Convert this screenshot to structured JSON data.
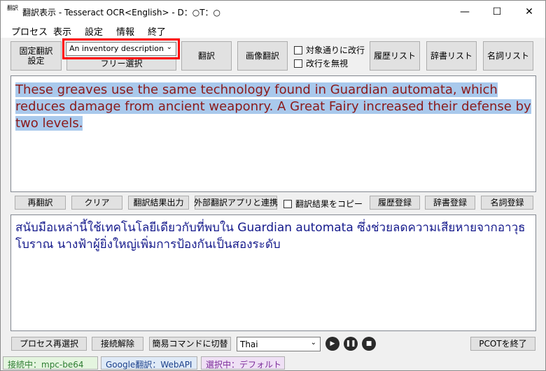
{
  "window": {
    "icon_glyphs": [
      "翻",
      "訳"
    ],
    "title": "翻訳表示 - Tesseract OCR<English> - D：○T：○",
    "minimize_glyph": "—",
    "maximize_glyph": "☐",
    "close_glyph": "✕"
  },
  "menu": [
    "プロセス",
    "表示",
    "設定",
    "情報",
    "終了"
  ],
  "toolbar": {
    "fixed_translation_line1": "固定翻訳",
    "fixed_translation_line2": "設定",
    "dropdown_value": "An inventory description",
    "free_select": "フリー選択",
    "translate": "翻訳",
    "image_translate": "画像翻訳",
    "checkbox_linebreak": "対象通りに改行",
    "checkbox_ignore_newline": "改行を無視",
    "history_list": "履歴リスト",
    "dictionary_list": "辞書リスト",
    "noun_list": "名詞リスト"
  },
  "source_text": "These greaves use the same technology found in Guardian automata, which reduces damage from ancient weaponry. A Great Fairy increased their defense by two levels.",
  "actions": {
    "retranslate": "再翻訳",
    "clear": "クリア",
    "output_result": "翻訳結果出力",
    "external_app": "外部翻訳アプリと連携",
    "copy_result": "翻訳結果をコピー",
    "history_register": "履歴登録",
    "dictionary_register": "辞書登録",
    "noun_register": "名詞登録"
  },
  "translated_text": "สนับมือเหล่านี้ใช้เทคโนโลยีเดียวกับที่พบใน Guardian automata ซึ่งช่วยลดความเสียหายจากอาวุธโบราณ นางฟ้าผู้ยิ่งใหญ่เพิ่มการป้องกันเป็นสองระดับ",
  "bottom": {
    "process_reselect": "プロセス再選択",
    "disconnect": "接続解除",
    "simple_command": "簡易コマンドに切替",
    "language": "Thai",
    "pcot_exit": "PCOTを終了"
  },
  "status": {
    "connection": "接続中：mpc-be64",
    "engine": "Google翻訳：WebAPI",
    "selection": "選択中：デフォルト"
  },
  "colors": {
    "source_text": "#8b1a1a",
    "source_highlight": "#a9c9ec",
    "translated_text": "#151a8c",
    "dropdown_highlight_border": "#ff0000",
    "status_connection_bg": "#e4f5df",
    "status_engine_bg": "#dfeaf7",
    "status_selection_bg": "#efe0f5"
  }
}
